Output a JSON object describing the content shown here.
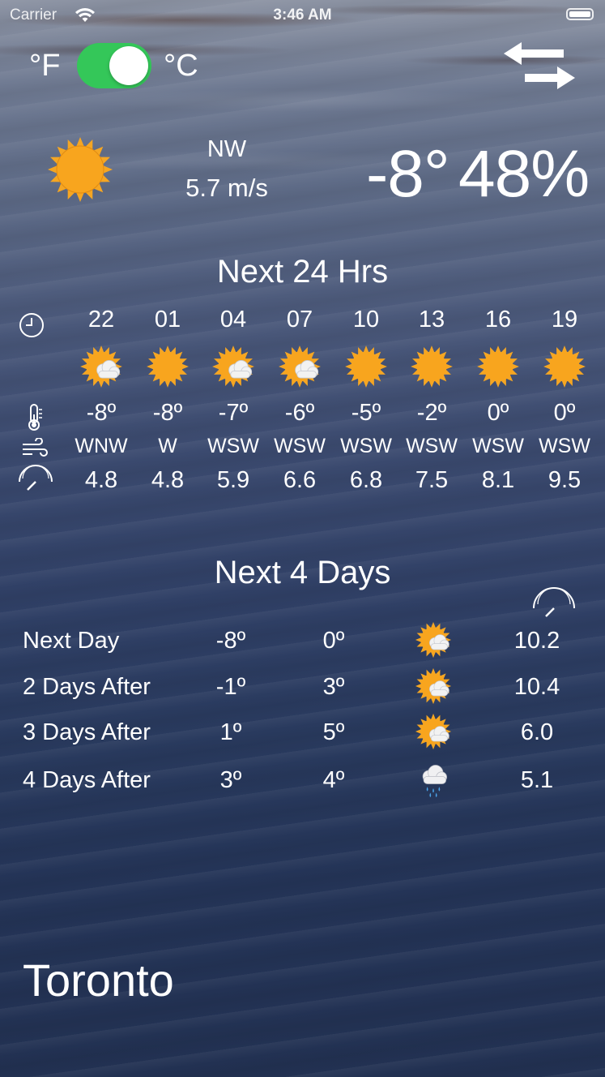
{
  "status_bar": {
    "carrier": "Carrier",
    "time": "3:46 AM"
  },
  "units": {
    "fahrenheit": "°F",
    "celsius": "°C",
    "celsius_enabled": true
  },
  "current": {
    "icon": "sun-icon",
    "wind_direction": "NW",
    "wind_speed": "5.7 m/s",
    "temperature": "-8°",
    "humidity": "48%"
  },
  "hourly": {
    "title": "Next 24 Hrs",
    "row_icons": [
      "clock-icon",
      "thermometer-icon",
      "wind-icon",
      "gauge-icon"
    ],
    "items": [
      {
        "time": "22",
        "icon": "partly-cloudy-icon",
        "temp": "-8º",
        "dir": "WNW",
        "speed": "4.8"
      },
      {
        "time": "01",
        "icon": "sun-icon",
        "temp": "-8º",
        "dir": "W",
        "speed": "4.8"
      },
      {
        "time": "04",
        "icon": "partly-cloudy-icon",
        "temp": "-7º",
        "dir": "WSW",
        "speed": "5.9"
      },
      {
        "time": "07",
        "icon": "partly-cloudy-icon",
        "temp": "-6º",
        "dir": "WSW",
        "speed": "6.6"
      },
      {
        "time": "10",
        "icon": "sun-icon",
        "temp": "-5º",
        "dir": "WSW",
        "speed": "6.8"
      },
      {
        "time": "13",
        "icon": "sun-icon",
        "temp": "-2º",
        "dir": "WSW",
        "speed": "7.5"
      },
      {
        "time": "16",
        "icon": "sun-icon",
        "temp": "0º",
        "dir": "WSW",
        "speed": "8.1"
      },
      {
        "time": "19",
        "icon": "sun-icon",
        "temp": "0º",
        "dir": "WSW",
        "speed": "9.5"
      }
    ]
  },
  "daily": {
    "title": "Next 4 Days",
    "header_icon": "gauge-icon",
    "items": [
      {
        "name": "Next Day",
        "low": "-8º",
        "high": "0º",
        "icon": "partly-cloudy-icon",
        "wind": "10.2"
      },
      {
        "name": "2 Days After",
        "low": "-1º",
        "high": "3º",
        "icon": "partly-cloudy-icon",
        "wind": "10.4"
      },
      {
        "name": "3 Days After",
        "low": "1º",
        "high": "5º",
        "icon": "partly-cloudy-icon",
        "wind": "6.0"
      },
      {
        "name": "4 Days After",
        "low": "3º",
        "high": "4º",
        "icon": "rain-cloud-icon",
        "wind": "5.1"
      }
    ]
  },
  "city": "Toronto",
  "colors": {
    "toggle_on": "#34c759",
    "sun": "#f5a623",
    "text": "#ffffff"
  }
}
